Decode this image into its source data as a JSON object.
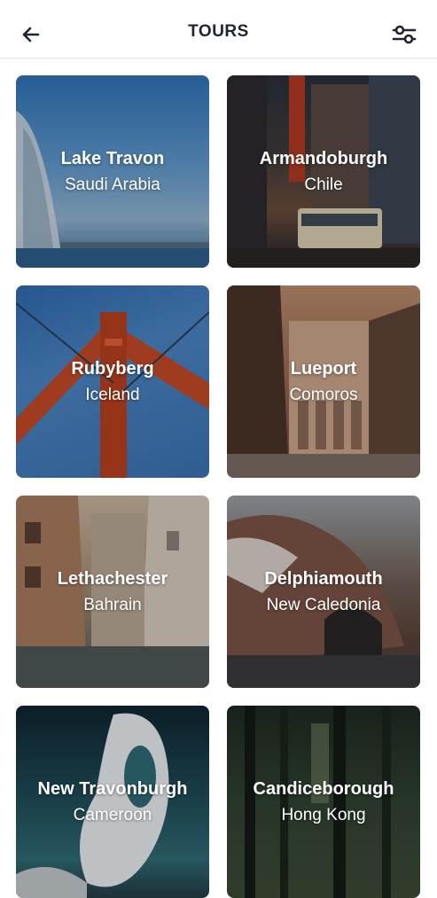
{
  "header": {
    "title": "TOURS",
    "back_icon": "arrow-left-icon",
    "filter_icon": "sliders-icon"
  },
  "tours": [
    {
      "name": "Lake Travon",
      "country": "Saudi Arabia"
    },
    {
      "name": "Armandoburgh",
      "country": "Chile"
    },
    {
      "name": "Rubyberg",
      "country": "Iceland"
    },
    {
      "name": "Lueport",
      "country": "Comoros"
    },
    {
      "name": "Lethachester",
      "country": "Bahrain"
    },
    {
      "name": "Delphiamouth",
      "country": "New Caledonia"
    },
    {
      "name": "New Travonburgh",
      "country": "Cameroon"
    },
    {
      "name": "Candiceborough",
      "country": "Hong Kong"
    }
  ]
}
